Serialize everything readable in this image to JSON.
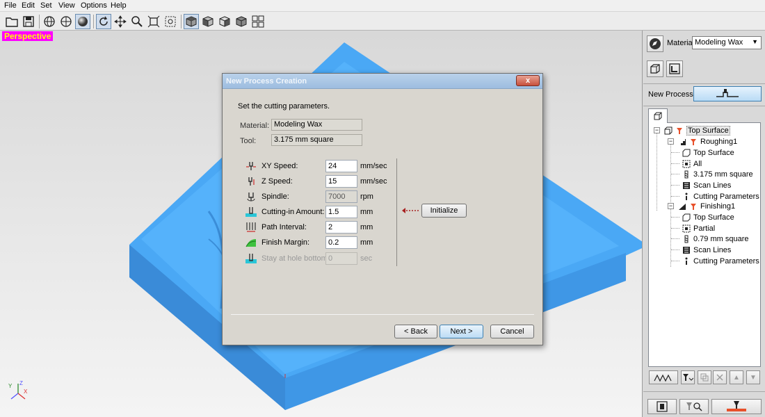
{
  "menu": [
    "File",
    "Edit",
    "Set",
    "View",
    "Options",
    "Help"
  ],
  "viewport": {
    "label": "Perspective"
  },
  "dialog": {
    "title": "New Process Creation",
    "close": "x",
    "instruction": "Set the cutting parameters.",
    "material_label": "Material:",
    "material_value": "Modeling Wax",
    "tool_label": "Tool:",
    "tool_value": "3.175 mm square",
    "params": [
      {
        "label": "XY Speed:",
        "value": "24",
        "unit": "mm/sec"
      },
      {
        "label": "Z Speed:",
        "value": "15",
        "unit": "mm/sec"
      },
      {
        "label": "Spindle:",
        "value": "7000",
        "unit": "rpm"
      },
      {
        "label": "Cutting-in Amount:",
        "value": "1.5",
        "unit": "mm"
      },
      {
        "label": "Path Interval:",
        "value": "2",
        "unit": "mm"
      },
      {
        "label": "Finish Margin:",
        "value": "0.2",
        "unit": "mm"
      },
      {
        "label": "Stay at hole bottom:",
        "value": "0",
        "unit": "sec"
      }
    ],
    "initialize": "Initialize",
    "back": "< Back",
    "next": "Next >",
    "cancel": "Cancel"
  },
  "panel": {
    "material_label": "Material",
    "material_value": "Modeling Wax",
    "new_process_label": "New Process",
    "tree": {
      "root": "Top Surface",
      "roughing": {
        "name": "Roughing1",
        "items": [
          "Top Surface",
          "All",
          "3.175 mm square",
          "Scan Lines",
          "Cutting Parameters"
        ]
      },
      "finishing": {
        "name": "Finishing1",
        "items": [
          "Top Surface",
          "Partial",
          "0.79 mm square",
          "Scan Lines",
          "Cutting Parameters"
        ]
      }
    }
  },
  "colors": {
    "model": "#4aa8f5",
    "perspective_bg": "#ff00ff",
    "perspective_fg": "#ffff00"
  }
}
